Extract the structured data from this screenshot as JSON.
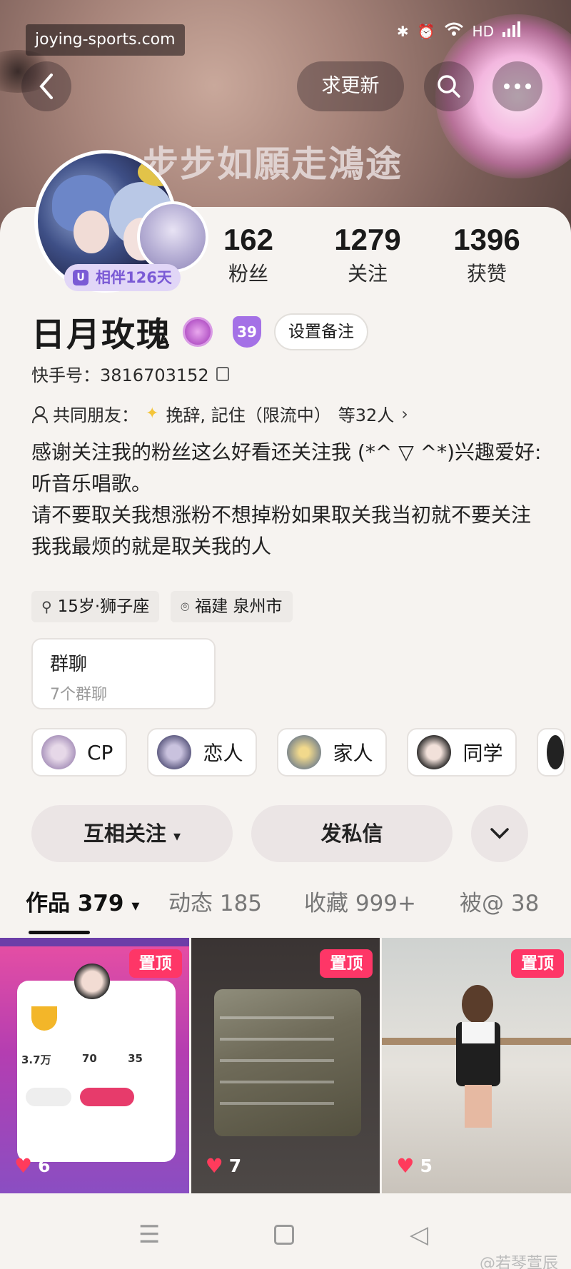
{
  "watermark_top": "joying-sports.com",
  "status": {
    "icons": [
      "bluetooth-icon",
      "alarm-icon",
      "wifi-icon",
      "hd-icon",
      "signal-icon",
      "battery-icon"
    ],
    "hd": "HD"
  },
  "header": {
    "request_update_label": "求更新",
    "banner_text": "步步如願走鴻途"
  },
  "profile": {
    "together_label": "相伴126天",
    "name": "日月玫瑰",
    "level": "39",
    "remark_label": "设置备注",
    "kuaishou_id": "快手号：3816703152",
    "mutual_prefix": "共同朋友：",
    "mutual_names": "挽辞, 記住（限流中）",
    "mutual_count": "等32人",
    "bio": [
      "感谢关注我的粉丝这么好看还关注我 (*^ ▽ ^*)兴趣爱好:听音乐唱歌。",
      "请不要取关我想涨粉不想掉粉如果取关我当初就不要关注我我最烦的就是取关我的人"
    ],
    "age_sign": "15岁·狮子座",
    "location": "福建 泉州市"
  },
  "stats": [
    {
      "num": "162",
      "label": "粉丝"
    },
    {
      "num": "1279",
      "label": "关注"
    },
    {
      "num": "1396",
      "label": "获赞"
    }
  ],
  "group": {
    "title": "群聊",
    "subtitle": "7个群聊"
  },
  "relations": [
    "CP",
    "恋人",
    "家人",
    "同学"
  ],
  "actions": {
    "follow_mutual": "互相关注",
    "message": "发私信"
  },
  "tabs": [
    {
      "label": "作品 379"
    },
    {
      "label": "动态 185"
    },
    {
      "label": "收藏 999+"
    },
    {
      "label": "被@ 38"
    }
  ],
  "grid": [
    {
      "pin": "置顶",
      "likes": "6",
      "stat_values": [
        "3.7万",
        "70",
        "35"
      ]
    },
    {
      "pin": "置顶",
      "likes": "7"
    },
    {
      "pin": "置顶",
      "likes": "5"
    }
  ],
  "watermark_bottom": "@若琴萱辰"
}
